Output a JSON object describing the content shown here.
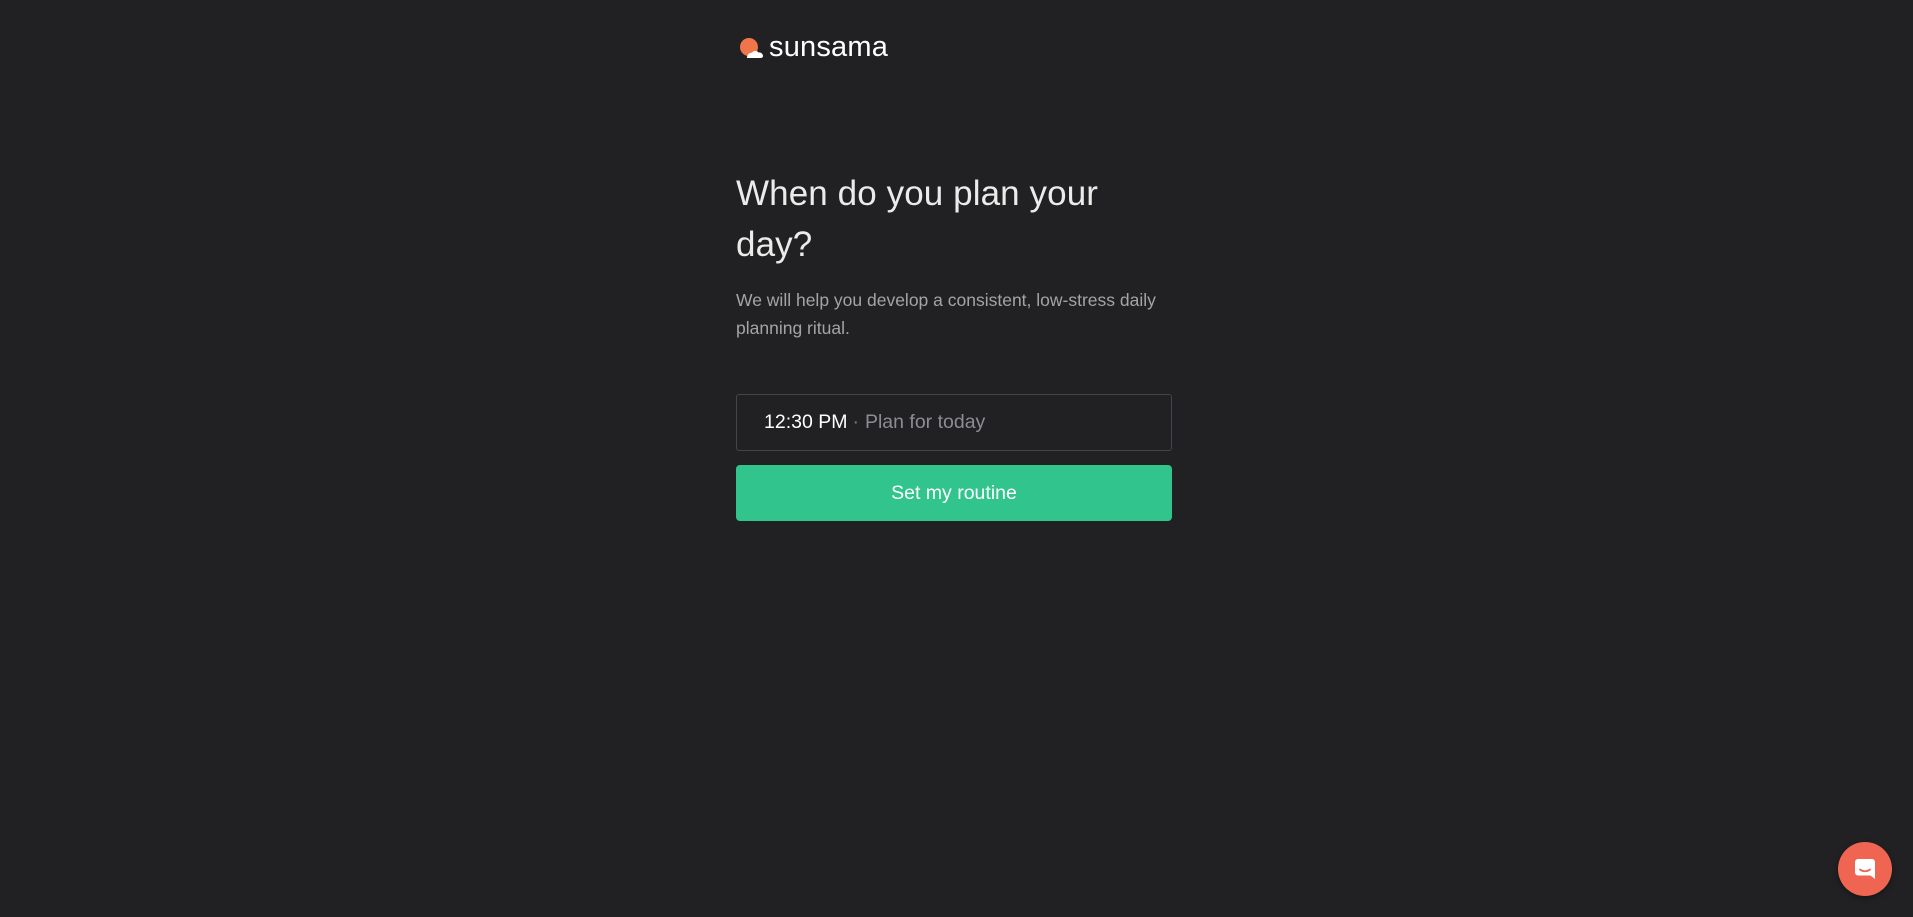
{
  "brand": {
    "name": "sunsama",
    "logo_icon": "sun-cloud-logo-icon",
    "colors": {
      "sun": "#f0754a",
      "cloud": "#ffffff"
    }
  },
  "main": {
    "heading": "When do you plan your day?",
    "subtext": "We will help you develop a consistent, low-stress daily planning ritual."
  },
  "planning_time": {
    "time": "12:30 PM",
    "separator": "·",
    "description": "Plan for today"
  },
  "actions": {
    "primary_label": "Set my routine",
    "primary_color": "#31c48d"
  },
  "chat": {
    "icon": "chat-bubble-icon",
    "color": "#ef6552"
  },
  "theme": {
    "background": "#212023"
  }
}
